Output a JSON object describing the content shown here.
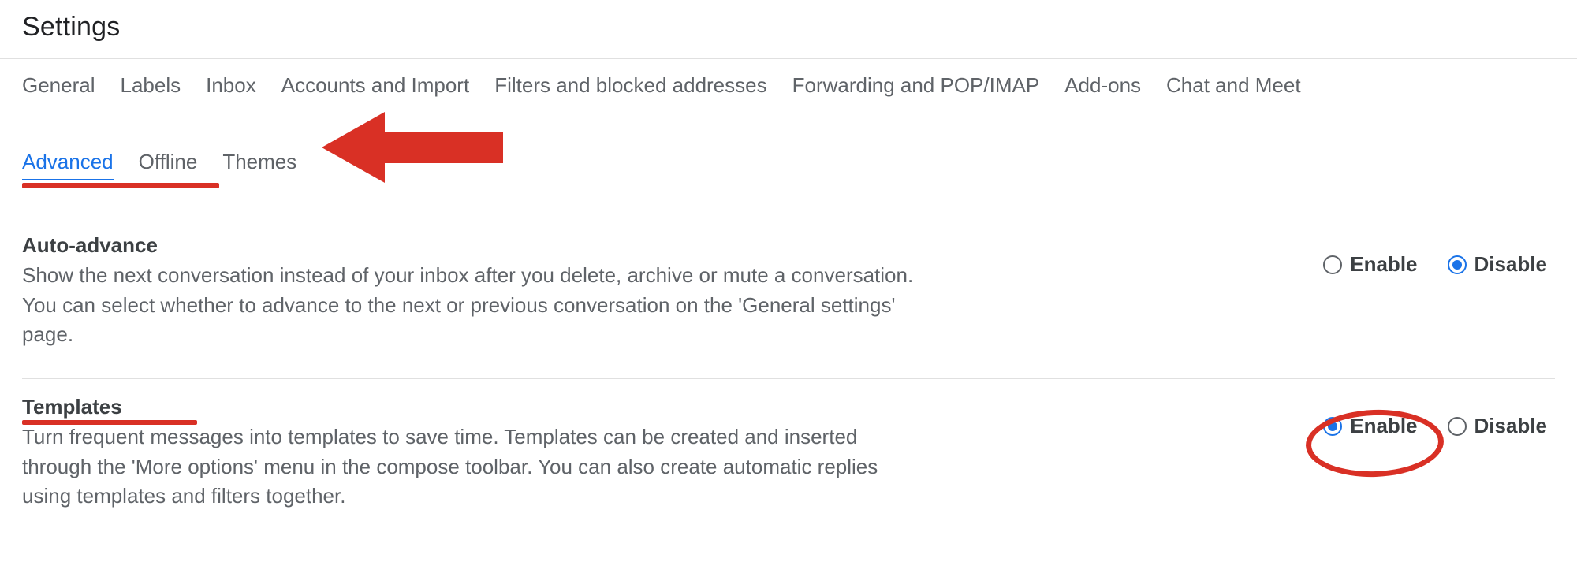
{
  "page": {
    "title": "Settings"
  },
  "tabs": {
    "row1": [
      "General",
      "Labels",
      "Inbox",
      "Accounts and Import",
      "Filters and blocked addresses",
      "Forwarding and POP/IMAP",
      "Add-ons",
      "Chat and Meet"
    ],
    "row2": [
      "Advanced",
      "Offline",
      "Themes"
    ],
    "active": "Advanced"
  },
  "settings": [
    {
      "title": "Auto-advance",
      "description": "Show the next conversation instead of your inbox after you delete, archive or mute a conversation. You can select whether to advance to the next or previous conversation on the 'General settings' page.",
      "enable_label": "Enable",
      "disable_label": "Disable",
      "selected": "disable",
      "annotated": false
    },
    {
      "title": "Templates",
      "description": "Turn frequent messages into templates to save time. Templates can be created and inserted through the 'More options' menu in the compose toolbar. You can also create automatic replies using templates and filters together.",
      "enable_label": "Enable",
      "disable_label": "Disable",
      "selected": "enable",
      "annotated": true
    }
  ],
  "annotations": {
    "arrow_color": "#d93025",
    "underline_color": "#d93025",
    "ellipse_color": "#d93025"
  }
}
